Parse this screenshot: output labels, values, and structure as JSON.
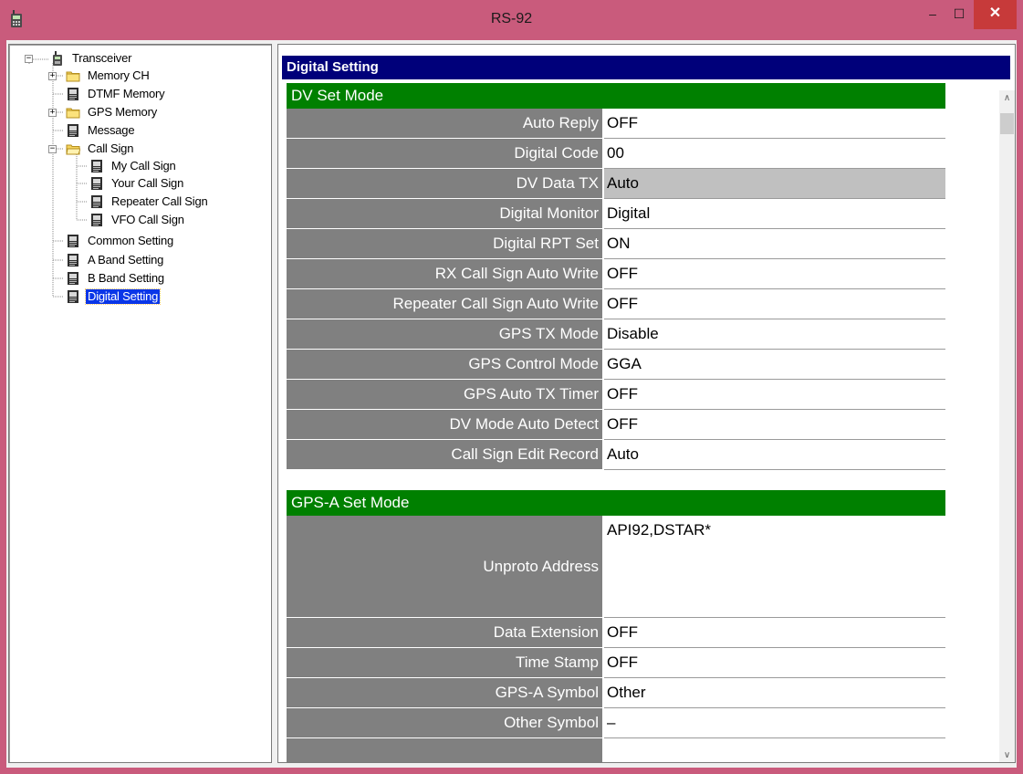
{
  "window": {
    "title": "RS-92",
    "minimize_glyph": "–",
    "maximize_glyph": "☐",
    "close_glyph": "✕"
  },
  "tree": {
    "items": [
      {
        "label": "Transceiver",
        "icon": "radio-icon",
        "expander": "−"
      },
      {
        "label": "Memory CH",
        "icon": "folder-icon",
        "expander": "+"
      },
      {
        "label": "DTMF Memory",
        "icon": "document-icon"
      },
      {
        "label": "GPS Memory",
        "icon": "folder-icon",
        "expander": "+"
      },
      {
        "label": "Message",
        "icon": "document-icon"
      },
      {
        "label": "Call Sign",
        "icon": "folder-open-icon",
        "expander": "−"
      },
      {
        "label": "My Call Sign",
        "icon": "document-icon"
      },
      {
        "label": "Your Call Sign",
        "icon": "document-icon"
      },
      {
        "label": "Repeater Call Sign",
        "icon": "document-icon"
      },
      {
        "label": "VFO Call Sign",
        "icon": "document-icon"
      },
      {
        "label": "Common Setting",
        "icon": "document-icon"
      },
      {
        "label": "A Band Setting",
        "icon": "document-icon"
      },
      {
        "label": "B Band Setting",
        "icon": "document-icon"
      },
      {
        "label": "Digital Setting",
        "icon": "document-icon",
        "selected": true
      }
    ]
  },
  "panel": {
    "title": "Digital Setting"
  },
  "dv_set_mode": {
    "heading": "DV Set Mode",
    "rows": [
      {
        "label": "Auto Reply",
        "value": "OFF"
      },
      {
        "label": "Digital Code",
        "value": "00"
      },
      {
        "label": "DV Data TX",
        "value": "Auto",
        "highlighted": true
      },
      {
        "label": "Digital Monitor",
        "value": "Digital"
      },
      {
        "label": "Digital RPT Set",
        "value": "ON"
      },
      {
        "label": "RX Call Sign Auto Write",
        "value": "OFF"
      },
      {
        "label": "Repeater Call Sign Auto Write",
        "value": "OFF"
      },
      {
        "label": "GPS TX Mode",
        "value": "Disable"
      },
      {
        "label": "GPS Control Mode",
        "value": "GGA"
      },
      {
        "label": "GPS Auto TX Timer",
        "value": "OFF"
      },
      {
        "label": "DV Mode Auto Detect",
        "value": "OFF"
      },
      {
        "label": "Call Sign Edit Record",
        "value": "Auto"
      }
    ]
  },
  "gps_a_set_mode": {
    "heading": "GPS-A Set Mode",
    "rows": [
      {
        "label": "Unproto Address",
        "value": "API92,DSTAR*"
      },
      {
        "label": "Data Extension",
        "value": "OFF"
      },
      {
        "label": "Time Stamp",
        "value": "OFF"
      },
      {
        "label": "GPS-A Symbol",
        "value": "Other"
      },
      {
        "label": "Other Symbol",
        "value": "–"
      },
      {
        "label": "",
        "value": ""
      }
    ]
  },
  "scrollbar": {
    "up_glyph": "∧",
    "down_glyph": "∨"
  },
  "colors": {
    "titlebar": "#c95b7c",
    "close_button": "#c73a3a",
    "panel_header": "#00007a",
    "section_header": "#008000",
    "label_cell": "#808080",
    "selection": "#0a36e8"
  }
}
